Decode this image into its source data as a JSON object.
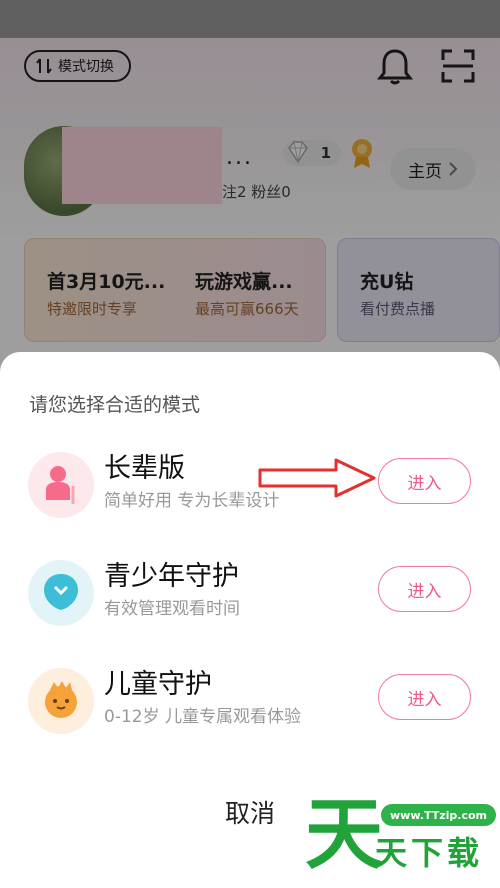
{
  "background": {
    "mode_switch_label": "模式切换",
    "diamond_count": "1",
    "stats_text": "注2  粉丝0",
    "name_suffix": "...",
    "home_label": "主页",
    "promos": [
      {
        "title": "首3月10元...",
        "subtitle": "特邀限时专享"
      },
      {
        "title": "玩游戏赢...",
        "subtitle": "最高可赢666天"
      },
      {
        "title": "充U钻",
        "subtitle": "看付费点播"
      }
    ]
  },
  "sheet": {
    "title": "请您选择合适的模式",
    "modes": [
      {
        "name": "长辈版",
        "desc": "简单好用 专为长辈设计",
        "button": "进入",
        "icon": "elder-icon",
        "color": "#f76b8a"
      },
      {
        "name": "青少年守护",
        "desc": "有效管理观看时间",
        "button": "进入",
        "icon": "teen-icon",
        "color": "#3cbfd6"
      },
      {
        "name": "儿童守护",
        "desc": "0-12岁 儿童专属观看体验",
        "button": "进入",
        "icon": "child-icon",
        "color": "#f5a23a"
      }
    ],
    "cancel": "取消"
  },
  "watermark": {
    "url": "www.TTzip.com",
    "big": "天",
    "small": "天下载"
  },
  "colors": {
    "accent": "#ef5a8a",
    "annotation_arrow": "#e53030"
  }
}
